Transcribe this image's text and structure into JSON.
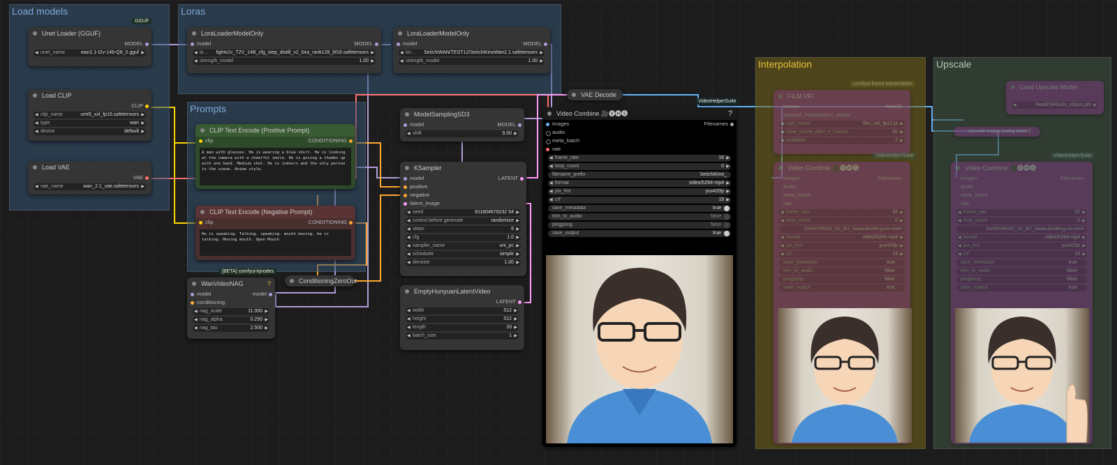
{
  "colors": {
    "model": "#b39ddb",
    "clip": "#ffd500",
    "vae": "#ff6e6e",
    "cond": "#ffa931",
    "latent": "#ff9cf9",
    "image": "#64b5f6"
  },
  "groups": {
    "load_models": "Load models",
    "loras": "Loras",
    "prompts": "Prompts",
    "interpolation": "Interpolation",
    "upscale": "Upscale"
  },
  "badges": {
    "gguf": "GGUF",
    "kjnodes": "[BETA] comfyui-kjnodes",
    "vhs": "VideoHelperSuite",
    "interp_src": "comfyui-frame-interpolation",
    "vhs2": "VideoHelperSuite",
    "vhs3": "VideoHelperSuite"
  },
  "unet": {
    "title": "Unet Loader (GGUF)",
    "out": "MODEL",
    "w_label": "unet_name",
    "w_value": "wan2.1-t2v-14b-Q8_0.gguf"
  },
  "clip": {
    "title": "Load CLIP",
    "out": "CLIP",
    "widgets": [
      {
        "label": "clip_name",
        "value": "umt5_xxl_fp16.safetensors"
      },
      {
        "label": "type",
        "value": "wan"
      },
      {
        "label": "device",
        "value": "default"
      }
    ]
  },
  "vae": {
    "title": "Load VAE",
    "out": "VAE",
    "w_label": "vae_name",
    "w_value": "wan_2.1_vae.safetensors"
  },
  "lora1": {
    "title": "LoraLoaderModelOnly",
    "in": "model",
    "out": "MODEL",
    "widgets": [
      {
        "label": "lo...",
        "value": "lightx2v_T2V_14B_cfg_step_distill_v2_lora_rank128_bf16.safetensors"
      },
      {
        "label": "strength_model",
        "value": "1.00"
      }
    ]
  },
  "lora2": {
    "title": "LoraLoaderModelOnly",
    "in": "model",
    "out": "MODEL",
    "widgets": [
      {
        "label": "lor...",
        "value": "SeiichiWAN/TEST12/SeiichiKinoWan2.1.safetensors"
      },
      {
        "label": "strength_model",
        "value": "1.00"
      }
    ]
  },
  "pos": {
    "title": "CLIP Text Encode (Positive Prompt)",
    "in": "clip",
    "out": "CONDITIONING",
    "text": "A man with glasses. He is wearing a blue shirt. He is looking at the camera with a cheerful smile. He is giving a thumbs up with one hand. Medium shot. He is indoors and the only person in the scene. Anime style."
  },
  "neg": {
    "title": "CLIP Text Encode (Negative Prompt)",
    "in": "clip",
    "out": "CONDITIONING",
    "text": "He is speaking. Talking. speaking. mouth moving. he is talking. Moving mouth. Open Mouth"
  },
  "msd3": {
    "title": "ModelSamplingSD3",
    "in": "model",
    "out": "MODEL",
    "w_label": "shift",
    "w_value": "9.00"
  },
  "ksampler": {
    "title": "KSampler",
    "out": "LATENT",
    "inputs": [
      "model",
      "positive",
      "negative",
      "latent_image"
    ],
    "widgets": [
      {
        "label": "seed",
        "value": "811804678232 54"
      },
      {
        "label": "control before generate",
        "value": "randomize"
      },
      {
        "label": "steps",
        "value": "6"
      },
      {
        "label": "cfg",
        "value": "1.0"
      },
      {
        "label": "sampler_name",
        "value": "uni_pc"
      },
      {
        "label": "scheduler",
        "value": "simple"
      },
      {
        "label": "denoise",
        "value": "1.00"
      }
    ]
  },
  "empty": {
    "title": "EmptyHunyuanLatentVideo",
    "out": "LATENT",
    "widgets": [
      {
        "label": "width",
        "value": "512"
      },
      {
        "label": "height",
        "value": "512"
      },
      {
        "label": "length",
        "value": "33"
      },
      {
        "label": "batch_size",
        "value": "1"
      }
    ]
  },
  "nag": {
    "title": "WanVideoNAG",
    "inputs": [
      "model",
      "conditioning"
    ],
    "out": "model",
    "widgets": [
      {
        "label": "nag_scale",
        "value": "11.000"
      },
      {
        "label": "nag_alpha",
        "value": "0.250"
      },
      {
        "label": "nag_tau",
        "value": "2.500"
      }
    ]
  },
  "czo": {
    "title": "ConditioningZeroOut"
  },
  "vaedecode": {
    "title": "VAE Decode"
  },
  "combine": {
    "title": "Video Combine 🎥🅥🅗🅢",
    "out": "Filenames",
    "help": "?",
    "inputs": [
      "images",
      "audio",
      "meta_batch",
      "vae"
    ],
    "widgets": [
      {
        "label": "frame_rate",
        "value": "16"
      },
      {
        "label": "loop_count",
        "value": "0"
      },
      {
        "label": "filename_prefix",
        "value": "SeiichiKino_"
      },
      {
        "label": "format",
        "value": "video/h264-mp4"
      },
      {
        "label": "pix_fmt",
        "value": "yuv420p"
      },
      {
        "label": "crf",
        "value": "19"
      }
    ],
    "toggles": [
      {
        "label": "save_metadata",
        "value": "true"
      },
      {
        "label": "trim_to_audio",
        "value": "false"
      },
      {
        "label": "pingpong",
        "value": "false"
      },
      {
        "label": "save_output",
        "value": "true"
      }
    ]
  },
  "film": {
    "title": "FILM VFI",
    "widgets": [
      {
        "label": "frames",
        "value": "IMAGE"
      },
      {
        "label": "optional_interpolation_states",
        "value": ""
      },
      {
        "label": "ckpt_name",
        "value": "film_net_fp32.pt"
      },
      {
        "label": "clear_cache_after_n_frames",
        "value": "20"
      },
      {
        "label": "multiplier",
        "value": "2"
      }
    ]
  },
  "upmodel": {
    "title": "Load Upscale Model",
    "w_label": "model_name",
    "w_value": "RealESRGAN_x2plus.pth"
  },
  "upimg": {
    "title": "Upscale Image (using Model)"
  },
  "combine2": {
    "title": "Video Combine 🎥🅥🅗🅢",
    "out": "Filenames",
    "inputs": [
      "images",
      "audio",
      "meta_batch",
      "vae"
    ],
    "widgets": [
      {
        "label": "frame_rate",
        "value": "32"
      },
      {
        "label": "loop_count",
        "value": "0"
      },
      {
        "label": "filename_prefix",
        "value": "I2V/INT/WVI2V_CC_INT_%date:dd-MM-yy-hh-mm%"
      },
      {
        "label": "format",
        "value": "video/h264-mp4"
      },
      {
        "label": "pix_fmt",
        "value": "yuv420p"
      },
      {
        "label": "crf",
        "value": "19"
      }
    ],
    "toggles": [
      {
        "label": "save_metadata",
        "value": "true"
      },
      {
        "label": "trim_to_audio",
        "value": "false"
      },
      {
        "label": "pingpong",
        "value": "false"
      },
      {
        "label": "save_output",
        "value": "true"
      }
    ]
  },
  "combine3": {
    "title": "Video Combine 🎥🅥🅗🅢",
    "out": "Filenames",
    "inputs": [
      "images",
      "audio",
      "meta_batch",
      "vae"
    ],
    "widgets": [
      {
        "label": "frame_rate",
        "value": "32"
      },
      {
        "label": "loop_count",
        "value": "0"
      },
      {
        "label": "filename_prefix",
        "value": "I2V/INT/WVI2V_CC_INT_%date:dd-MM-yy-hh-mm%"
      },
      {
        "label": "format",
        "value": "video/h264-mp4"
      },
      {
        "label": "pix_fmt",
        "value": "yuv420p"
      },
      {
        "label": "crf",
        "value": "19"
      }
    ],
    "toggles": [
      {
        "label": "save_metadata",
        "value": "true"
      },
      {
        "label": "trim_to_audio",
        "value": "false"
      },
      {
        "label": "pingpong",
        "value": "false"
      },
      {
        "label": "save_output",
        "value": "true"
      }
    ]
  }
}
